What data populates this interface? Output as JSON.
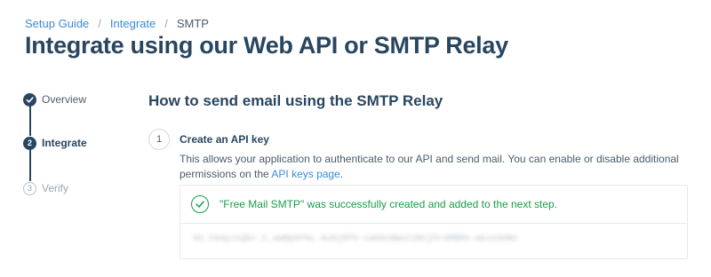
{
  "breadcrumb": {
    "items": [
      "Setup Guide",
      "Integrate",
      "SMTP"
    ],
    "separator": "/"
  },
  "page_title": "Integrate using our Web API or SMTP Relay",
  "steps": {
    "overview": {
      "label": "Overview",
      "status": "complete",
      "icon": "check-icon"
    },
    "integrate": {
      "number": "2",
      "label": "Integrate",
      "status": "current"
    },
    "verify": {
      "number": "3",
      "label": "Verify",
      "status": "pending"
    }
  },
  "section_heading": "How to send email using the SMTP Relay",
  "step1": {
    "number": "1",
    "title": "Create an API key",
    "description_prefix": "This allows your application to authenticate to our API and send mail. You can enable or disable additional permissions on the ",
    "link_text": "API keys page",
    "description_suffix": "."
  },
  "result": {
    "success_message": "\"Free Mail SMTP\" was successfully created and added to the next step.",
    "api_key_masked": "SG.Fm4pJxQbr_C_aWBpHY8L.8uNjRfk-xaKDcNWcC2BCjhrdMBRe.wkxeSHNc",
    "success_color": "#1a9c4b"
  },
  "colors": {
    "primary": "#294661",
    "link": "#3a8bd6",
    "success": "#1a9c4b"
  }
}
